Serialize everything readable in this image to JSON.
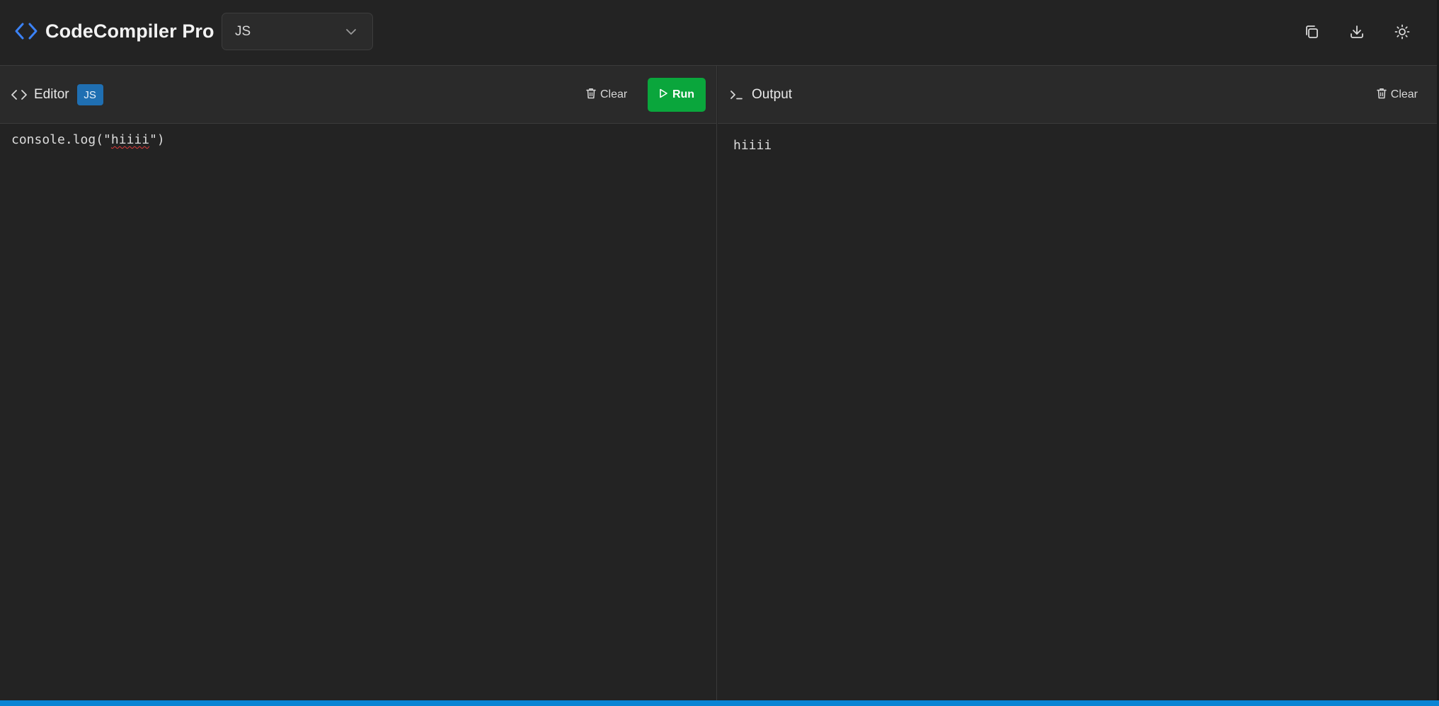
{
  "app": {
    "title": "CodeCompiler Pro"
  },
  "language_select": {
    "value": "JS"
  },
  "top_actions": {
    "icons": [
      "copy-icon",
      "download-icon",
      "sun-icon"
    ]
  },
  "editor": {
    "title": "Editor",
    "language_badge": "JS",
    "clear_label": "Clear",
    "run_label": "Run",
    "code": {
      "prefix": "console.log(\"",
      "flagged_word": "hiiii",
      "suffix": "\")"
    }
  },
  "output": {
    "title": "Output",
    "clear_label": "Clear",
    "text": "hiiii"
  },
  "colors": {
    "background": "#232323",
    "header": "#2a2a2a",
    "accent_blue": "#3b82f6",
    "badge": "#1f6fb2",
    "run_green": "#0aa63c",
    "statusbar": "#0a84d4",
    "spellcheck": "#e03a3a"
  }
}
